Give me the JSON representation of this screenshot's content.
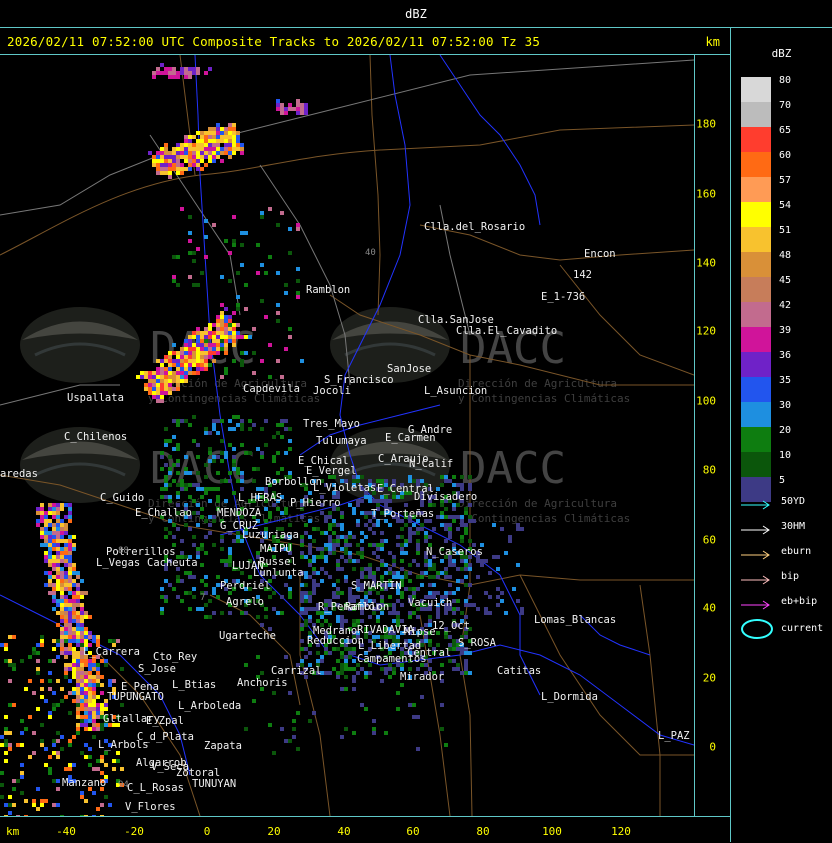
{
  "title": "dBZ",
  "header": {
    "caption": "2026/02/11 07:52:00 UTC Composite Tracks to 2026/02/11 07:52:00 Tz 35",
    "unit": "km"
  },
  "axes": {
    "x_unit": "km",
    "x_ticks": [
      "-40",
      "-20",
      "0",
      "20",
      "40",
      "60",
      "80",
      "100",
      "120"
    ],
    "y_ticks": [
      "180",
      "160",
      "140",
      "120",
      "100",
      "80",
      "60",
      "40",
      "20",
      "0"
    ]
  },
  "legend": {
    "title": "dBZ",
    "scale": [
      {
        "label": "80",
        "color": "#d8d8d8"
      },
      {
        "label": "70",
        "color": "#bcbcbc"
      },
      {
        "label": "65",
        "color": "#ff3d2e"
      },
      {
        "label": "60",
        "color": "#ff6a14"
      },
      {
        "label": "57",
        "color": "#ff9b55"
      },
      {
        "label": "54",
        "color": "#ffff00"
      },
      {
        "label": "51",
        "color": "#f8c22e"
      },
      {
        "label": "48",
        "color": "#d99038"
      },
      {
        "label": "45",
        "color": "#c77d5a"
      },
      {
        "label": "42",
        "color": "#c26b8e"
      },
      {
        "label": "39",
        "color": "#d0149a"
      },
      {
        "label": "36",
        "color": "#6f22c8"
      },
      {
        "label": "35",
        "color": "#2255ee"
      },
      {
        "label": "30",
        "color": "#1e8fe0"
      },
      {
        "label": "20",
        "color": "#0e7d10"
      },
      {
        "label": "10",
        "color": "#0b560b"
      },
      {
        "label": "5",
        "color": "#3d3a85"
      }
    ],
    "tracks": [
      {
        "label": "50YD",
        "color": "#33ffff"
      },
      {
        "label": "30HM",
        "color": "#ffffff"
      },
      {
        "label": "eburn",
        "color": "#ffd080"
      },
      {
        "label": "bip",
        "color": "#ffc0c0"
      },
      {
        "label": "eb+bip",
        "color": "#ff44ff"
      }
    ],
    "current_label": "current",
    "current_color": "#33ffff"
  },
  "watermark": {
    "logo_text": "DACC",
    "line1": "Dirección de Agricultura",
    "line2": "y Contingencias Climáticas"
  },
  "places": [
    {
      "name": "Clla.del_Rosario"
    },
    {
      "name": "Encon"
    },
    {
      "name": "142"
    },
    {
      "name": "E_1-736"
    },
    {
      "name": "Ramblon"
    },
    {
      "name": "Clla.SanJose"
    },
    {
      "name": "Clla.El_Cavadito"
    },
    {
      "name": "SanJose"
    },
    {
      "name": "S_Francisco"
    },
    {
      "name": "Jocoli"
    },
    {
      "name": "L_Asuncion"
    },
    {
      "name": "Uspallata"
    },
    {
      "name": "Capdevila"
    },
    {
      "name": "Tres_Mayo"
    },
    {
      "name": "G_Andre"
    },
    {
      "name": "Tulumaya"
    },
    {
      "name": "E_Carmen"
    },
    {
      "name": "C_Chilenos"
    },
    {
      "name": "E_Chical"
    },
    {
      "name": "C_Araujo"
    },
    {
      "name": "N_Calif"
    },
    {
      "name": "E_Vergel"
    },
    {
      "name": "Borbollon"
    },
    {
      "name": "L_Violetas"
    },
    {
      "name": "E_Central"
    },
    {
      "name": "Divisadero"
    },
    {
      "name": "L_HERAS"
    },
    {
      "name": "P_Hierro"
    },
    {
      "name": "C_Guido"
    },
    {
      "name": "E_Challao"
    },
    {
      "name": "MENDOZA"
    },
    {
      "name": "T_Porteñas"
    },
    {
      "name": "G_CRUZ"
    },
    {
      "name": "Luzuriaga"
    },
    {
      "name": "N_Caseros"
    },
    {
      "name": "MAIPU"
    },
    {
      "name": "Potrerillos"
    },
    {
      "name": "Cacheuta"
    },
    {
      "name": "Russel"
    },
    {
      "name": "L_Vegas"
    },
    {
      "name": "LUJAN"
    },
    {
      "name": "Lunlunta"
    },
    {
      "name": "S_MARTIN"
    },
    {
      "name": "Perdriel"
    },
    {
      "name": "Agrelo"
    },
    {
      "name": "R_Penaflor"
    },
    {
      "name": "Ramblon"
    },
    {
      "name": "Ugarteche"
    },
    {
      "name": "12_Oct"
    },
    {
      "name": "Medrano"
    },
    {
      "name": "RIVADAVIA"
    },
    {
      "name": "Reduccion"
    },
    {
      "name": "L_Libertad"
    },
    {
      "name": "Lomas_Blancas"
    },
    {
      "name": "S_ROSA"
    },
    {
      "name": "L_Carrera"
    },
    {
      "name": "Cto_Rey"
    },
    {
      "name": "S_Jose"
    },
    {
      "name": "Carrizal"
    },
    {
      "name": "Campamentos"
    },
    {
      "name": "Central"
    },
    {
      "name": "Catitas"
    },
    {
      "name": "E_Pena"
    },
    {
      "name": "L_Btias"
    },
    {
      "name": "Anchoris"
    },
    {
      "name": "Mirador"
    },
    {
      "name": "TUPUNGATO"
    },
    {
      "name": "L_Arboleda"
    },
    {
      "name": "L_Dormida"
    },
    {
      "name": "Gltallary"
    },
    {
      "name": "E_Zpal"
    },
    {
      "name": "C_d_Plata"
    },
    {
      "name": "L_Arbols"
    },
    {
      "name": "Zapata"
    },
    {
      "name": "Algarrob"
    },
    {
      "name": "V_Seca"
    },
    {
      "name": "Zotoral"
    },
    {
      "name": "TUNUYAN"
    },
    {
      "name": "Manzano"
    },
    {
      "name": "C_L_Rosas"
    },
    {
      "name": "V_Flores"
    },
    {
      "name": "L_PAZ"
    },
    {
      "name": "aredas"
    },
    {
      "name": "Mipse"
    },
    {
      "name": "Vacuich"
    }
  ]
}
